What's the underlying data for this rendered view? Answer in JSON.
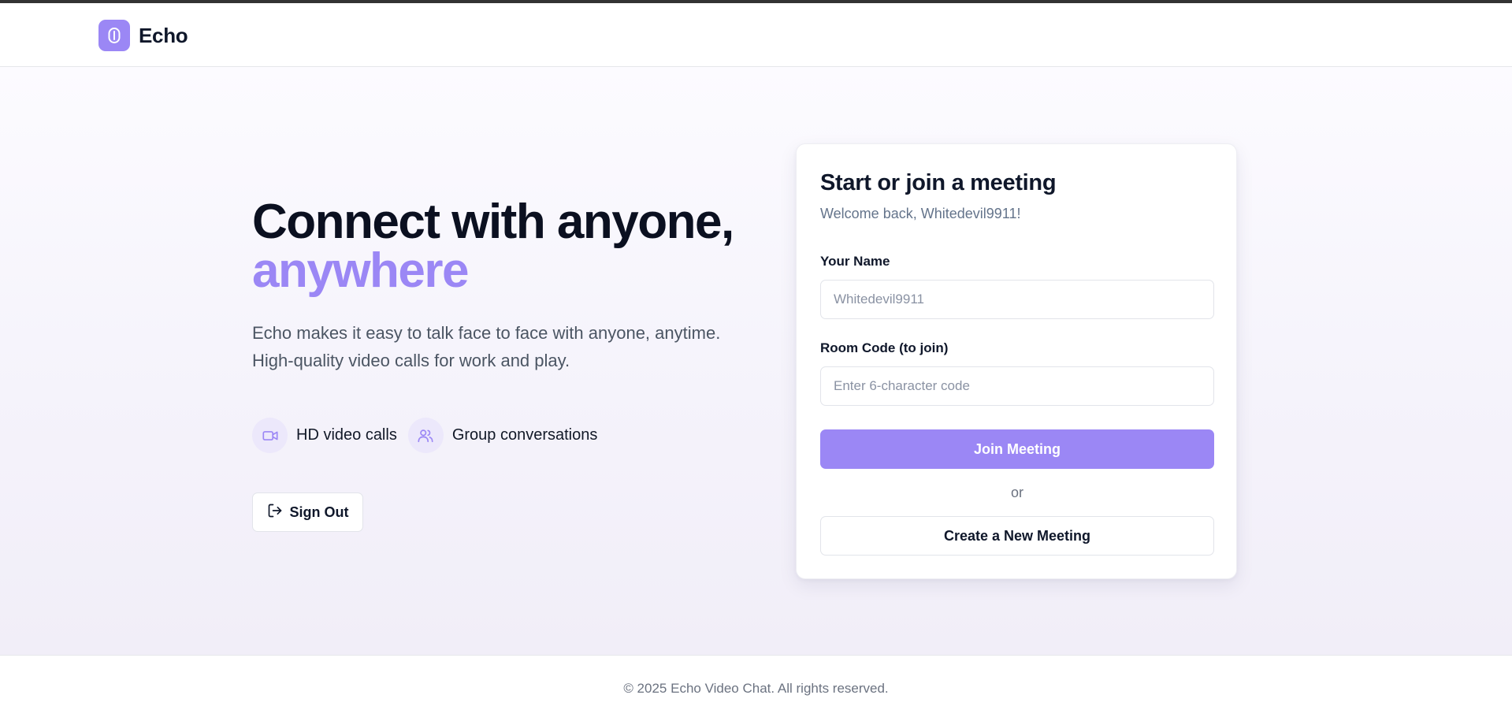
{
  "colors": {
    "accent": "#9b87f5",
    "accent_soft": "#ece8fb",
    "text_dark": "#0f172a",
    "text_muted": "#64748b"
  },
  "header": {
    "brand_name": "Echo",
    "logo_icon": "echo-logo-icon"
  },
  "hero": {
    "headline_line1": "Connect with anyone,",
    "headline_line2": "anywhere",
    "lead_line1": "Echo makes it easy to talk face to face with anyone, anytime.",
    "lead_line2": "High-quality video calls for work and play.",
    "features": [
      {
        "icon": "video-camera-icon",
        "label": "HD video calls"
      },
      {
        "icon": "users-icon",
        "label": "Group conversations"
      }
    ],
    "sign_out": {
      "icon": "log-out-icon",
      "label": "Sign Out"
    }
  },
  "meeting_card": {
    "title": "Start or join a meeting",
    "subtitle": "Welcome back, Whitedevil9911!",
    "name_field": {
      "label": "Your Name",
      "value": "",
      "placeholder": "Whitedevil9911"
    },
    "room_field": {
      "label": "Room Code (to join)",
      "value": "",
      "placeholder": "Enter 6-character code"
    },
    "join_button": "Join Meeting",
    "or_text": "or",
    "create_button": "Create a New Meeting"
  },
  "footer": {
    "copyright": "© 2025 Echo Video Chat. All rights reserved."
  }
}
